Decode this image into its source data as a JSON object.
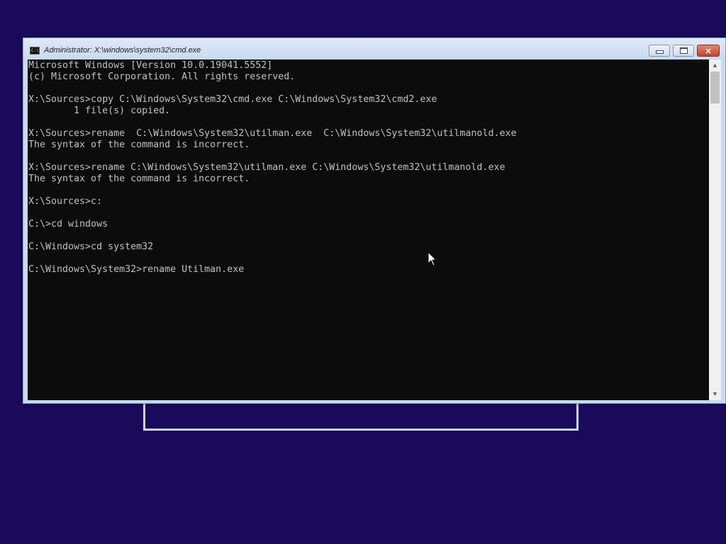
{
  "window": {
    "title": "Administrator: X:\\windows\\system32\\cmd.exe",
    "icon": "cmd-icon",
    "icon_label": "C:\\",
    "buttons": {
      "minimize": "minimize-icon",
      "maximize": "maximize-icon",
      "close": "×"
    }
  },
  "console": {
    "background": "#0c0c0c",
    "foreground": "#c0c0c0",
    "lines": [
      "Microsoft Windows [Version 10.0.19041.5552]",
      "(c) Microsoft Corporation. All rights reserved.",
      "",
      "X:\\Sources>copy C:\\Windows\\System32\\cmd.exe C:\\Windows\\System32\\cmd2.exe",
      "        1 file(s) copied.",
      "",
      "X:\\Sources>rename  C:\\Windows\\System32\\utilman.exe  C:\\Windows\\System32\\utilmanold.exe",
      "The syntax of the command is incorrect.",
      "",
      "X:\\Sources>rename C:\\Windows\\System32\\utilman.exe C:\\Windows\\System32\\utilmanold.exe",
      "The syntax of the command is incorrect.",
      "",
      "X:\\Sources>c:",
      "",
      "C:\\>cd windows",
      "",
      "C:\\Windows>cd system32",
      "",
      "C:\\Windows\\System32>rename Utilman.exe"
    ]
  },
  "scrollbar": {
    "up": "▲",
    "down": "▼"
  },
  "colors": {
    "desktop": "#1b0a5c",
    "titlebar": "#c9daf0",
    "close_button": "#c0442a"
  }
}
